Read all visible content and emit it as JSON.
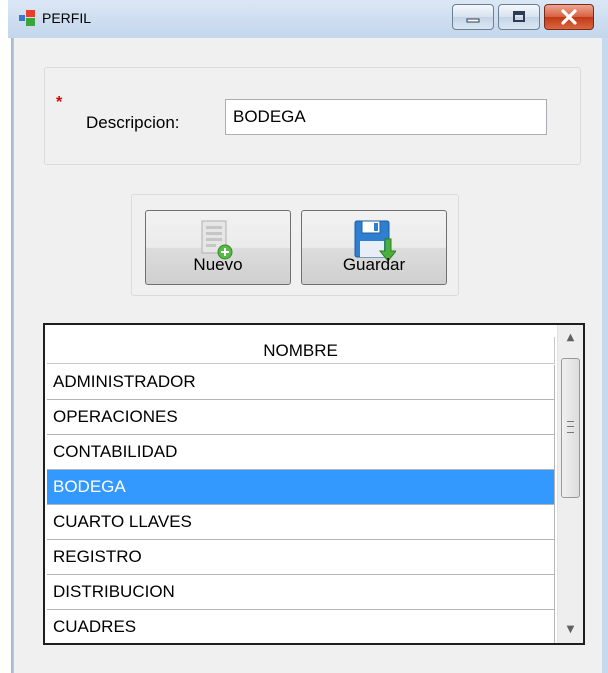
{
  "window": {
    "title": "PERFIL",
    "icon": "form-icon",
    "controls": [
      "minimize-icon",
      "maximize-icon",
      "close-icon"
    ]
  },
  "form": {
    "required_marker": "*",
    "descripcion_label": "Descripcion:",
    "descripcion_value": "BODEGA"
  },
  "toolbar": {
    "nuevo_label": "Nuevo",
    "nuevo_icon": "new-document-icon",
    "guardar_label": "Guardar",
    "guardar_icon": "save-icon"
  },
  "grid": {
    "header": "NOMBRE",
    "rows": [
      "ADMINISTRADOR",
      "OPERACIONES",
      "CONTABILIDAD",
      "BODEGA",
      "CUARTO LLAVES",
      "REGISTRO",
      "DISTRIBUCION",
      "CUADRES"
    ],
    "selected_row": "BODEGA",
    "selection_color": "#3399ff"
  }
}
